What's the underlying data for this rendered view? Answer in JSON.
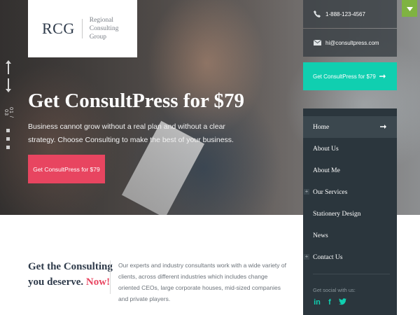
{
  "logo": {
    "mark": "RCG",
    "company_line1": "Regional Consulting",
    "company_line2": "Group"
  },
  "slider": {
    "counter": "01 / 03"
  },
  "hero": {
    "title": "Get ConsultPress for $79",
    "description": "Business cannot grow without a real plan and without a clear strategy. Choose Consulting to make the best of your business.",
    "button_label": "Get ConsultPress for $79"
  },
  "intro": {
    "heading_part1": "Get the Consulting you deserve.",
    "heading_accent": "Now!",
    "text": "Our experts and industry consultants work with a wide variety of clients, across different industries which includes change oriented CEOs, large corporate houses, mid-sized companies and private players."
  },
  "sidebar": {
    "phone": "1-888-123-4567",
    "email": "hi@consultpress.com",
    "cta_label": "Get ConsultPress for $79",
    "nav": [
      {
        "label": "Home",
        "active": true,
        "has_submenu": false
      },
      {
        "label": "About Us",
        "active": false,
        "has_submenu": false
      },
      {
        "label": "About Me",
        "active": false,
        "has_submenu": false
      },
      {
        "label": "Our Services",
        "active": false,
        "has_submenu": true
      },
      {
        "label": "Stationery Design",
        "active": false,
        "has_submenu": false
      },
      {
        "label": "News",
        "active": false,
        "has_submenu": false
      },
      {
        "label": "Contact Us",
        "active": false,
        "has_submenu": true
      }
    ],
    "social_label": "Get social with us:",
    "social_icons": [
      "linkedin-icon",
      "facebook-icon",
      "twitter-icon"
    ]
  },
  "colors": {
    "accent_pink": "#e84560",
    "accent_teal": "#10cfb0",
    "nav_bg": "#2b363d",
    "heading_navy": "#2e3a4a",
    "corner_tab_green": "#7fb342"
  }
}
